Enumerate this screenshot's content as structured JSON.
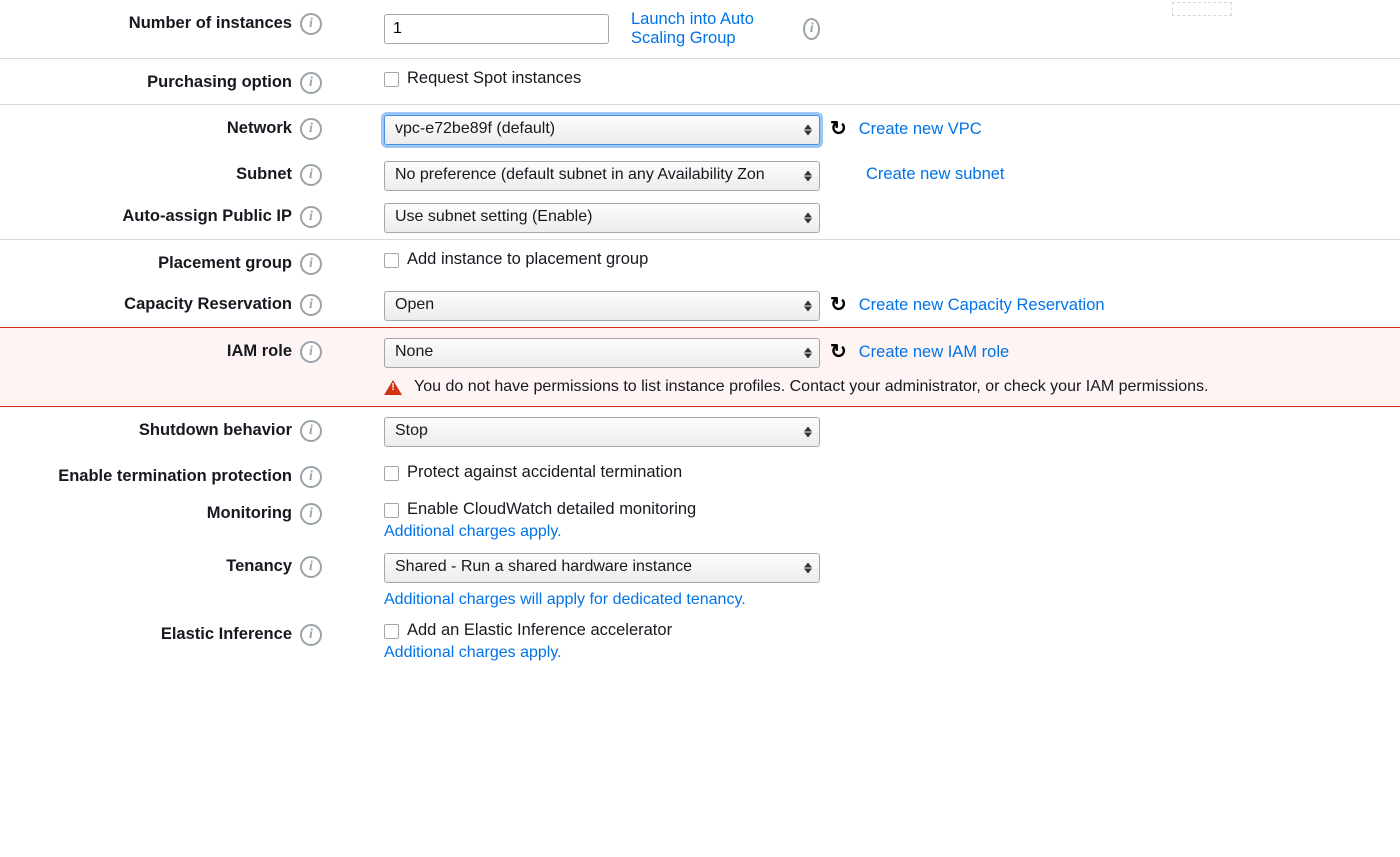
{
  "numberOfInstances": {
    "label": "Number of instances",
    "value": "1",
    "autoScalingLink": "Launch into Auto Scaling Group"
  },
  "purchasingOption": {
    "label": "Purchasing option",
    "checkboxLabel": "Request Spot instances"
  },
  "network": {
    "label": "Network",
    "value": "vpc-e72be89f (default)",
    "createLink": "Create new VPC"
  },
  "subnet": {
    "label": "Subnet",
    "value": "No preference (default subnet in any Availability Zon",
    "createLink": "Create new subnet"
  },
  "autoAssignPublicIp": {
    "label": "Auto-assign Public IP",
    "value": "Use subnet setting (Enable)"
  },
  "placementGroup": {
    "label": "Placement group",
    "checkboxLabel": "Add instance to placement group"
  },
  "capacityReservation": {
    "label": "Capacity Reservation",
    "value": "Open",
    "createLink": "Create new Capacity Reservation"
  },
  "iamRole": {
    "label": "IAM role",
    "value": "None",
    "createLink": "Create new IAM role",
    "errorMessage": "You do not have permissions to list instance profiles. Contact your administrator, or check your IAM permissions."
  },
  "shutdownBehavior": {
    "label": "Shutdown behavior",
    "value": "Stop"
  },
  "terminationProtection": {
    "label": "Enable termination protection",
    "checkboxLabel": "Protect against accidental termination"
  },
  "monitoring": {
    "label": "Monitoring",
    "checkboxLabel": "Enable CloudWatch detailed monitoring",
    "chargesLink": "Additional charges apply."
  },
  "tenancy": {
    "label": "Tenancy",
    "value": "Shared - Run a shared hardware instance",
    "chargesLink": "Additional charges will apply for dedicated tenancy."
  },
  "elasticInference": {
    "label": "Elastic Inference",
    "checkboxLabel": "Add an Elastic Inference accelerator",
    "chargesLink": "Additional charges apply."
  }
}
